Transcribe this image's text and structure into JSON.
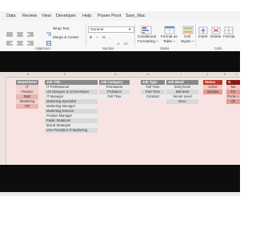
{
  "ribbon": {
    "tabs": [
      "Data",
      "Review",
      "View",
      "Developer",
      "Help",
      "Power Pivot",
      "Sam_Mac"
    ],
    "wrap_text": "Wrap Text",
    "merge_center": "Merge & Center",
    "number_format": "General",
    "number_symbols": "$ ~ % ,",
    "conditional_formatting": [
      "Conditional",
      "Formatting ~"
    ],
    "format_as_table": [
      "Format as",
      "Table ~"
    ],
    "cell_styles": [
      "Cell",
      "Styles ~"
    ],
    "insert": "Insert",
    "delete": "Delete",
    "format": "Format",
    "groups": {
      "alignment": "Alignment",
      "number": "Number",
      "styles": "Styles",
      "cells": "Cells"
    }
  },
  "columns": [
    "E",
    "F",
    "G",
    "H",
    "I",
    "J",
    "K",
    "L"
  ],
  "colors": {
    "header_gray": "#8a8a8a",
    "header_red": "#c0392b",
    "header_dark_red": "#8b1a10",
    "sheet_bg": "#f7e4e2",
    "cell_gray": "#d9d9d9",
    "cell_red": "#e69a94"
  },
  "tables": {
    "department": {
      "header": "Department",
      "items": [
        "IT",
        "Finance",
        "R&D",
        "Marketing",
        "HR"
      ]
    },
    "job_title": {
      "header": "Job Title",
      "items": [
        "IT Professional",
        "UX Designer & UI Developer",
        "IT Manager",
        "Marketing Specialist",
        "Marketing Manager",
        "Marketing Director",
        "Product Manager",
        "Public Relations",
        "Brand Strategist",
        "Vice President of Marketing"
      ]
    },
    "job_category": {
      "header": "Job Category",
      "items": [
        "Permanent",
        "Probation",
        "Full Time"
      ]
    },
    "job_type": {
      "header": "Job Type",
      "items": [
        "Full Time",
        "Part Time",
        "Contract"
      ]
    },
    "job_band": {
      "header": "Job Band",
      "items": [
        "Entry-level",
        "Mid-level",
        "Senior Level",
        "Exec"
      ]
    },
    "status": {
      "header": "Status",
      "items": [
        "Active",
        "Inactive"
      ]
    },
    "last_column": {
      "header": "G",
      "items": [
        "Ma",
        "Fe",
        "Prefer n",
        "Ot"
      ]
    }
  }
}
